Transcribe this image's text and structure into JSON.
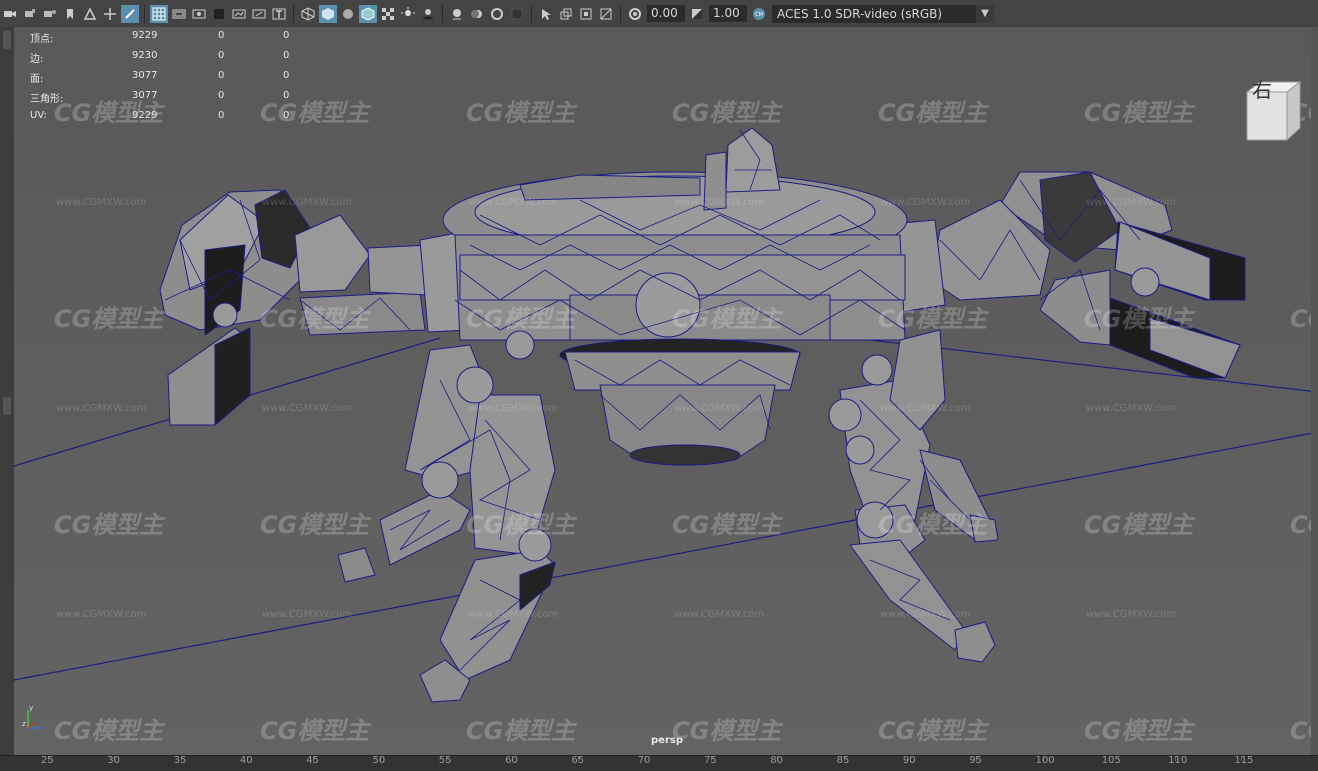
{
  "toolbar": {
    "exposure_value": "0.00",
    "gamma_value": "1.00",
    "color_space": "ACES 1.0 SDR-video (sRGB)",
    "accent_color": "#5a8fae"
  },
  "hud": {
    "rows": [
      {
        "label": "顶点:",
        "v1": "9229",
        "v2": "0",
        "v3": "0"
      },
      {
        "label": "边:",
        "v1": "9230",
        "v2": "0",
        "v3": "0"
      },
      {
        "label": "面:",
        "v1": "3077",
        "v2": "0",
        "v3": "0"
      },
      {
        "label": "三角形:",
        "v1": "3077",
        "v2": "0",
        "v3": "0"
      },
      {
        "label": "UV:",
        "v1": "9229",
        "v2": "0",
        "v3": "0"
      }
    ]
  },
  "viewcube": {
    "label": "右"
  },
  "viewport": {
    "camera_label": "persp",
    "wireframe_color": "#1c1c86",
    "background_color": "#5d5d5d"
  },
  "watermark": {
    "logo_text": "CG模型主",
    "url_text": "www.CGMXW.com"
  },
  "ruler": {
    "ticks": [
      "25",
      "30",
      "35",
      "40",
      "45",
      "50",
      "55",
      "60",
      "65",
      "70",
      "75",
      "80",
      "85",
      "90",
      "95",
      "100",
      "105",
      "110",
      "115"
    ]
  },
  "axis_labels": {
    "y": "y",
    "z": "z"
  }
}
